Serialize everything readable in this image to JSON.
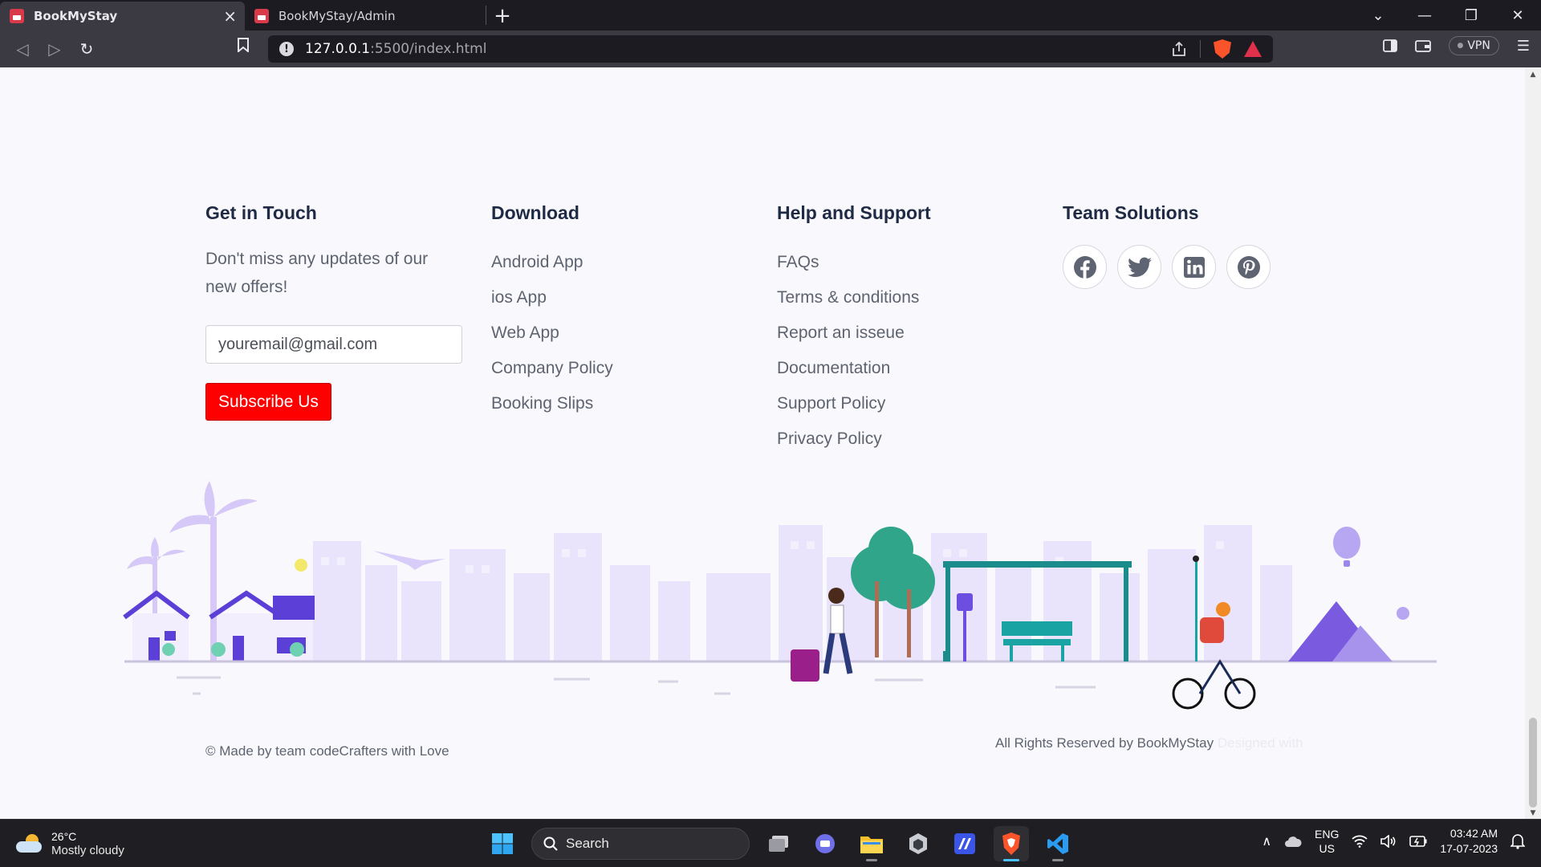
{
  "browser": {
    "tabs": [
      {
        "title": "BookMyStay",
        "active": true
      },
      {
        "title": "BookMyStay/Admin",
        "active": false
      }
    ],
    "url_host": "127.0.0.1",
    "url_path": ":5500/index.html",
    "vpn_label": "VPN"
  },
  "footer": {
    "get_in_touch": {
      "heading": "Get in Touch",
      "description": "Don't miss any updates of our new offers!",
      "email_placeholder": "youremail@gmail.com",
      "subscribe_label": "Subscribe Us"
    },
    "download": {
      "heading": "Download",
      "links": [
        "Android App",
        "ios App",
        "Web App",
        "Company Policy",
        "Booking Slips"
      ]
    },
    "help": {
      "heading": "Help and Support",
      "links": [
        "FAQs",
        "Terms & conditions",
        "Report an isseue",
        "Documentation",
        "Support Policy",
        "Privacy Policy"
      ]
    },
    "team": {
      "heading": "Team Solutions",
      "socials": [
        "facebook-icon",
        "twitter-icon",
        "linkedin-icon",
        "pinterest-icon"
      ]
    },
    "copyright": "© Made by team codeCrafters with Love",
    "rights": "All Rights Reserved by BookMyStay",
    "rights_faded": "Designed with"
  },
  "taskbar": {
    "temperature": "26°C",
    "weather": "Mostly cloudy",
    "search_label": "Search",
    "lang_1": "ENG",
    "lang_2": "US",
    "time": "03:42 AM",
    "date": "17-07-2023"
  },
  "colors": {
    "accent_red": "#ff0000",
    "heading": "#1f2b45",
    "illustration_purple": "#6c4ee0"
  }
}
